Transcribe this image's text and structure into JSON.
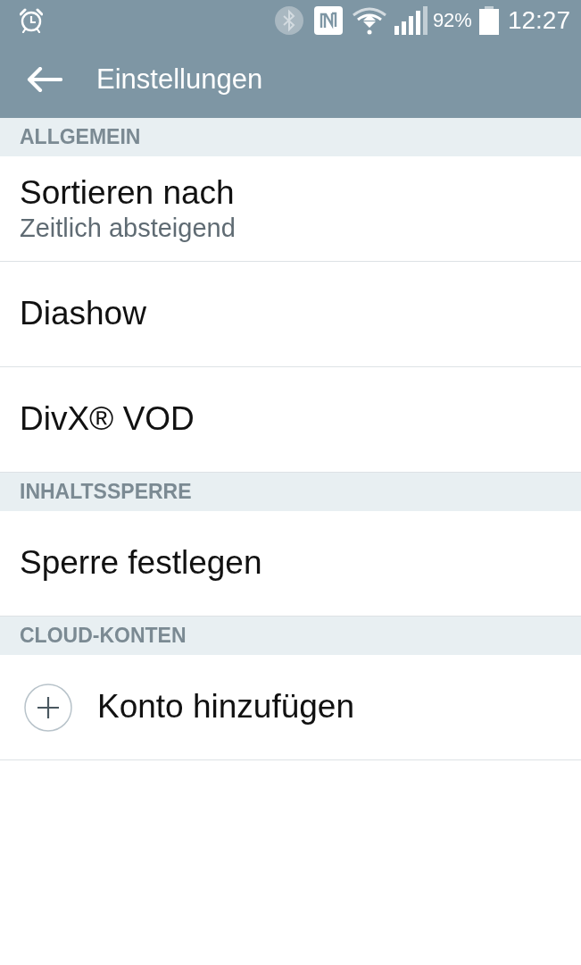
{
  "status_bar": {
    "bluetooth_on": false,
    "battery_percent": "92%",
    "time": "12:27"
  },
  "app_bar": {
    "title": "Einstellungen"
  },
  "sections": [
    {
      "header": "ALLGEMEIN",
      "items": [
        {
          "kind": "text",
          "title": "Sortieren nach",
          "subtitle": "Zeitlich absteigend"
        },
        {
          "kind": "text",
          "title": "Diashow"
        },
        {
          "kind": "text",
          "title": "DivX® VOD"
        }
      ]
    },
    {
      "header": "INHALTSSPERRE",
      "items": [
        {
          "kind": "text",
          "title": "Sperre festlegen"
        }
      ]
    },
    {
      "header": "CLOUD-KONTEN",
      "items": [
        {
          "kind": "add",
          "title": "Konto hinzufügen"
        }
      ]
    }
  ]
}
